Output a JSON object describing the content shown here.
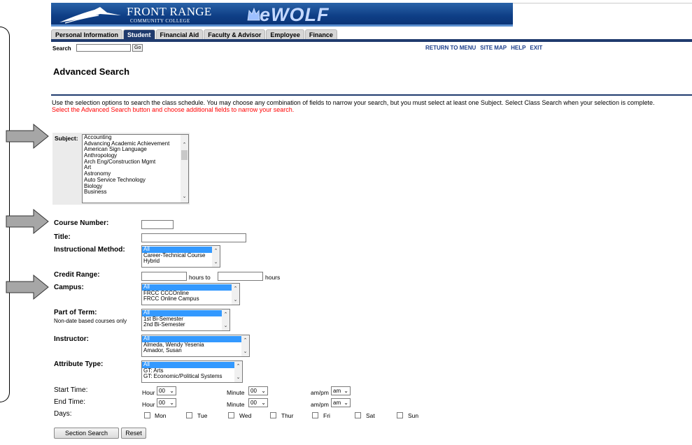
{
  "banner": {
    "brand_name": "FRONT RANGE",
    "brand_sub": "COMMUNITY COLLEGE",
    "product": "eWOLF"
  },
  "tabs": [
    {
      "label": "Personal Information",
      "active": false
    },
    {
      "label": "Student",
      "active": true
    },
    {
      "label": "Financial Aid",
      "active": false
    },
    {
      "label": "Faculty & Advisor",
      "active": false
    },
    {
      "label": "Employee",
      "active": false
    },
    {
      "label": "Finance",
      "active": false
    }
  ],
  "search": {
    "label": "Search",
    "go_label": "Go",
    "value": ""
  },
  "toplinks": {
    "return": "RETURN TO MENU",
    "sitemap": "SITE MAP",
    "help": "HELP",
    "exit": "EXIT"
  },
  "page_title": "Advanced Search",
  "intro": {
    "line1": "Use the selection options to search the class schedule. You may choose any combination of fields to narrow your search, but you must select at least one Subject. Select Class Search when your selection is complete.",
    "line2": "Select the Advanced Search button and choose additional fields to narrow your search."
  },
  "subject": {
    "label": "Subject:",
    "options": [
      "Accounting",
      "Advancing Academic Achievement",
      "American Sign Language",
      "Anthropology",
      "Arch Eng/Construction Mgmt",
      "Art",
      "Astronomy",
      "Auto Service Technology",
      "Biology",
      "Business"
    ]
  },
  "course_number": {
    "label": "Course Number:",
    "value": ""
  },
  "title": {
    "label": "Title:",
    "value": ""
  },
  "instructional_method": {
    "label": "Instructional Method:",
    "options": [
      "All",
      "Career-Technical Course",
      "Hybrid"
    ]
  },
  "credit_range": {
    "label": "Credit Range:",
    "mid": "hours to",
    "end": "hours"
  },
  "campus": {
    "label": "Campus:",
    "options": [
      "All",
      "FRCC CCCOnline",
      "FRCC Online Campus"
    ]
  },
  "part_of_term": {
    "label": "Part of Term:",
    "note": "Non-date based courses only",
    "options": [
      "All",
      "1st Bi-Semester",
      "2nd Bi-Semester"
    ]
  },
  "instructor": {
    "label": "Instructor:",
    "options": [
      "All",
      "Almeda, Wendy Yesenia",
      "Amador, Susan"
    ]
  },
  "attribute_type": {
    "label": "Attribute Type:",
    "options": [
      "All",
      "GT: Arts",
      "GT: Economic/Political Systems"
    ]
  },
  "start_time": {
    "label": "Start Time:",
    "hour_label": "Hour",
    "hour": "00",
    "minute_label": "Minute",
    "minute": "00",
    "ampm_label": "am/pm",
    "ampm": "am"
  },
  "end_time": {
    "label": "End Time:",
    "hour_label": "Hour",
    "hour": "00",
    "minute_label": "Minute",
    "minute": "00",
    "ampm_label": "am/pm",
    "ampm": "am"
  },
  "days": {
    "label": "Days:",
    "items": [
      "Mon",
      "Tue",
      "Wed",
      "Thur",
      "Fri",
      "Sat",
      "Sun"
    ]
  },
  "buttons": {
    "section_search": "Section Search",
    "reset": "Reset"
  },
  "colors": {
    "banner_blue": "#0f3f86",
    "tab_active": "#203b6e",
    "selection": "#3399ff",
    "warning_text": "#ff0000",
    "link": "#1a3d8a"
  }
}
